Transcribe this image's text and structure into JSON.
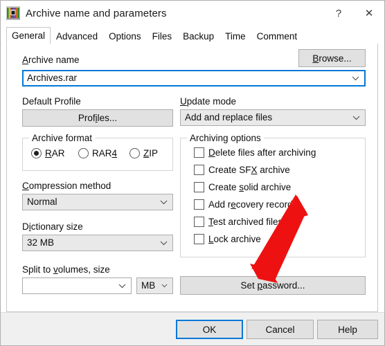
{
  "window": {
    "title": "Archive name and parameters",
    "icon": "winrar-books-icon",
    "help_button": "?",
    "close_button": "✕"
  },
  "tabs": [
    {
      "label": "General",
      "active": true
    },
    {
      "label": "Advanced",
      "active": false
    },
    {
      "label": "Options",
      "active": false
    },
    {
      "label": "Files",
      "active": false
    },
    {
      "label": "Backup",
      "active": false
    },
    {
      "label": "Time",
      "active": false
    },
    {
      "label": "Comment",
      "active": false
    }
  ],
  "archive_name": {
    "label_pre": "",
    "label_accel": "A",
    "label_post": "rchive name",
    "value": "Archives.rar",
    "browse_pre": "",
    "browse_accel": "B",
    "browse_post": "rowse..."
  },
  "default_profile": {
    "label": "Default Profile",
    "button_pre": "Prof",
    "button_accel": "i",
    "button_post": "les..."
  },
  "update_mode": {
    "label_accel": "U",
    "label_post": "pdate mode",
    "value": "Add and replace files"
  },
  "archive_format": {
    "caption": "Archive format",
    "options": [
      {
        "accel": "R",
        "rest": "AR",
        "selected": true
      },
      {
        "accel": "",
        "rest": "RAR",
        "accel_tail": "4",
        "selected": false
      },
      {
        "accel": "Z",
        "rest": "IP",
        "selected": false
      }
    ]
  },
  "compression_method": {
    "label_accel": "C",
    "label_post": "ompression method",
    "value": "Normal"
  },
  "dictionary_size": {
    "label_pre": "D",
    "label_accel": "i",
    "label_post": "ctionary size",
    "value": "32 MB"
  },
  "split_volumes": {
    "label_pre": "Split to ",
    "label_accel": "v",
    "label_post": "olumes, size",
    "value": "",
    "unit": "MB"
  },
  "archiving_options": {
    "caption": "Archiving options",
    "items": [
      {
        "pre": "",
        "accel": "D",
        "post": "elete files after archiving",
        "checked": false
      },
      {
        "pre": "Create SF",
        "accel": "X",
        "post": " archive",
        "checked": false
      },
      {
        "pre": "Create ",
        "accel": "s",
        "post": "olid archive",
        "checked": false
      },
      {
        "pre": "Add r",
        "accel": "e",
        "post": "covery record",
        "checked": false
      },
      {
        "pre": "",
        "accel": "T",
        "post": "est archived files",
        "checked": false
      },
      {
        "pre": "",
        "accel": "L",
        "post": "ock archive",
        "checked": false
      }
    ]
  },
  "set_password": {
    "pre": "Set ",
    "accel": "p",
    "post": "assword..."
  },
  "footer": {
    "ok": "OK",
    "cancel": "Cancel",
    "help": "Help"
  },
  "annotation": {
    "type": "red-arrow",
    "color": "#ee1111",
    "points_to": "set-password-button"
  }
}
